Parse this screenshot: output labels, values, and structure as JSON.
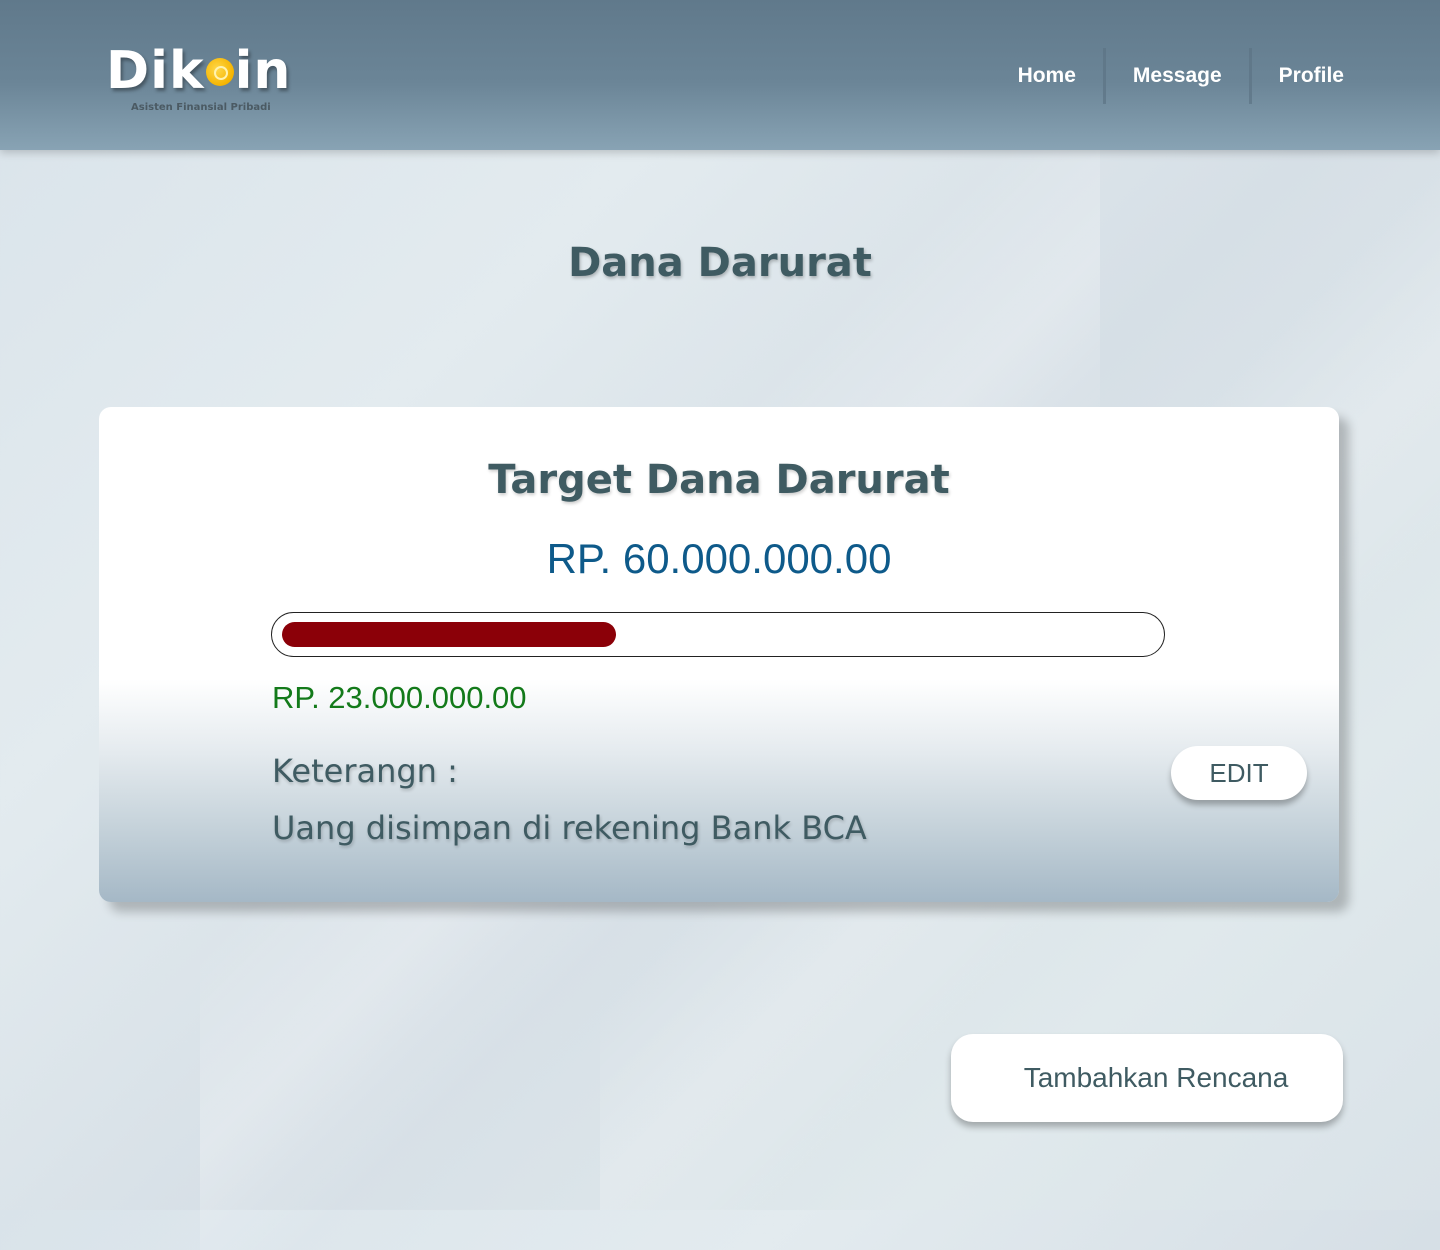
{
  "app": {
    "logo_text_before": "Dik",
    "logo_text_after": "in",
    "logo_coin_icon": "coin-icon",
    "tagline": "Asisten Finansial Pribadi"
  },
  "nav": {
    "items": [
      {
        "label": "Home"
      },
      {
        "label": "Message"
      },
      {
        "label": "Profile"
      }
    ]
  },
  "page": {
    "title": "Dana Darurat"
  },
  "card": {
    "title": "Target Dana Darurat",
    "target_amount": "RP. 60.000.000.00",
    "current_amount": "RP. 23.000.000.00",
    "progress_fraction": 0.383,
    "progress_color": "#8b0008",
    "description_label": "Keterangn :",
    "description_text": "Uang disimpan di rekening Bank BCA",
    "edit_label": "EDIT"
  },
  "actions": {
    "add_plan_label": "Tambahkan Rencana"
  },
  "colors": {
    "heading": "#3f5b62",
    "target_amount": "#0e5a8a",
    "current_amount": "#137a1a",
    "navbar": "#6b8597"
  }
}
